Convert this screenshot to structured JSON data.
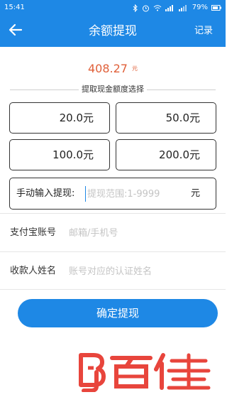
{
  "status_bar": {
    "time": "15:41",
    "battery": "79%"
  },
  "header": {
    "title": "余额提现",
    "record_label": "记录"
  },
  "balance": {
    "amount": "408.27",
    "unit": "元"
  },
  "section": {
    "title": "提取现金额度选择"
  },
  "options": [
    {
      "label": "20.0元"
    },
    {
      "label": "50.0元"
    },
    {
      "label": "100.0元"
    },
    {
      "label": "200.0元"
    }
  ],
  "manual": {
    "label": "手动输入提现:",
    "placeholder": "提现范围:1-9999",
    "unit": "元"
  },
  "alipay": {
    "label": "支付宝账号",
    "placeholder": "邮箱/手机号"
  },
  "payee": {
    "label": "收款人姓名",
    "placeholder": "账号对应的认证姓名"
  },
  "confirm": {
    "label": "确定提现"
  },
  "watermark": {
    "text": "百佳"
  },
  "colors": {
    "primary": "#1e88e5",
    "balance": "#e0603a",
    "watermark": "#e8453c"
  }
}
